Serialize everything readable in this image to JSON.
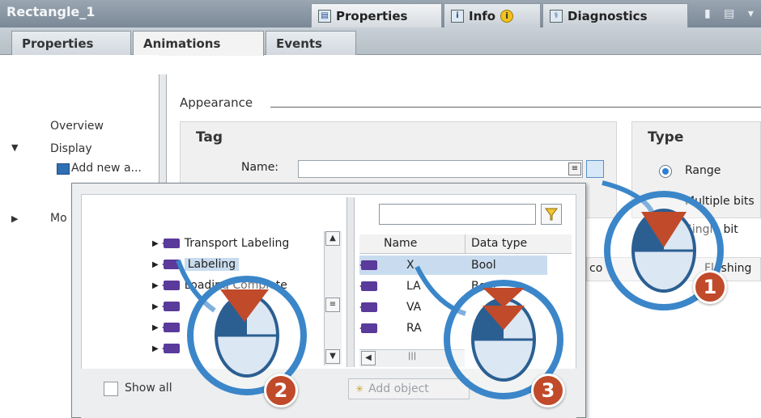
{
  "window": {
    "title": "Rectangle_1",
    "tabs": [
      {
        "label": "Properties",
        "icon": "properties-icon"
      },
      {
        "label": "Info",
        "icon": "info-icon"
      },
      {
        "label": "Diagnostics",
        "icon": "diagnostics-icon"
      }
    ]
  },
  "subtabs": [
    "Properties",
    "Animations",
    "Events"
  ],
  "tree": {
    "items": [
      "Overview",
      "Display",
      "Add new a...",
      "Mo"
    ]
  },
  "appearance": {
    "section_label": "Appearance",
    "tag": {
      "title": "Tag",
      "name_label": "Name:",
      "name_value": ""
    },
    "type": {
      "title": "Type",
      "options": [
        {
          "label": "Range",
          "selected": true
        },
        {
          "label": "Multiple bits",
          "selected": false
        },
        {
          "label": "Single bit",
          "selected": false
        }
      ]
    }
  },
  "popup": {
    "objects": [
      "Transport Labeling",
      "Labeling",
      "Loading Complete",
      "",
      "",
      ""
    ],
    "search_value": "",
    "columns": [
      "Name",
      "Data type"
    ],
    "rows": [
      {
        "name": "X",
        "type": "Bool"
      },
      {
        "name": "LA",
        "type": "Bool"
      },
      {
        "name": "VA",
        "type": ""
      },
      {
        "name": "RA",
        "type": ""
      }
    ],
    "show_all_label": "Show all",
    "add_object_label": "Add object"
  },
  "right_grid": {
    "col_partial": "co",
    "col_flashing": "Flashing"
  },
  "callouts": [
    "1",
    "2",
    "3"
  ],
  "colors": {
    "accent": "#3b86c9",
    "badge": "#c04a2a",
    "selection": "#c9dcef"
  }
}
